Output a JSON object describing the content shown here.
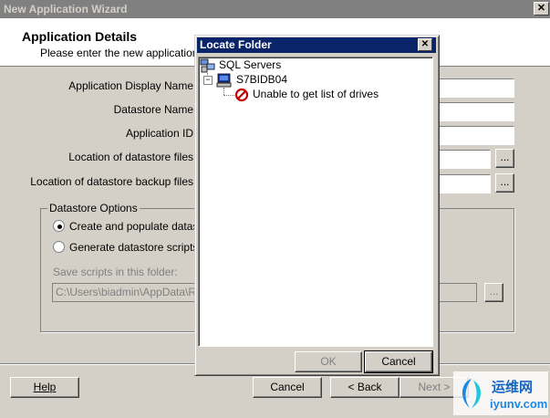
{
  "wizard": {
    "title": "New Application Wizard",
    "close_glyph": "✕",
    "header_title": "Application Details",
    "header_subtitle": "Please enter the new applications c"
  },
  "form": {
    "display_name_label": "Application Display Name",
    "datastore_name_label": "Datastore Name",
    "app_id_label": "Application ID",
    "location_label": "Location of datastore files",
    "backup_label": "Location of datastore backup files",
    "browse_label": "..."
  },
  "options": {
    "group_title": "Datastore Options",
    "radio1": "Create and populate datastor",
    "radio2": "Generate datastore scripts ar",
    "save_scripts_label": "Save scripts in this folder:",
    "path_value": "C:\\Users\\biadmin\\AppData\\Ro"
  },
  "footer": {
    "help": "Help",
    "cancel": "Cancel",
    "back": "< Back",
    "next": "Next >"
  },
  "dialog": {
    "title": "Locate Folder",
    "close_glyph": "✕",
    "tree": {
      "root": "SQL Servers",
      "server": "S7BIDB04",
      "error": "Unable to get list of drives"
    },
    "ok": "OK",
    "cancel": "Cancel"
  },
  "watermark": {
    "brand": "运维网",
    "site": "iyunv.com"
  }
}
